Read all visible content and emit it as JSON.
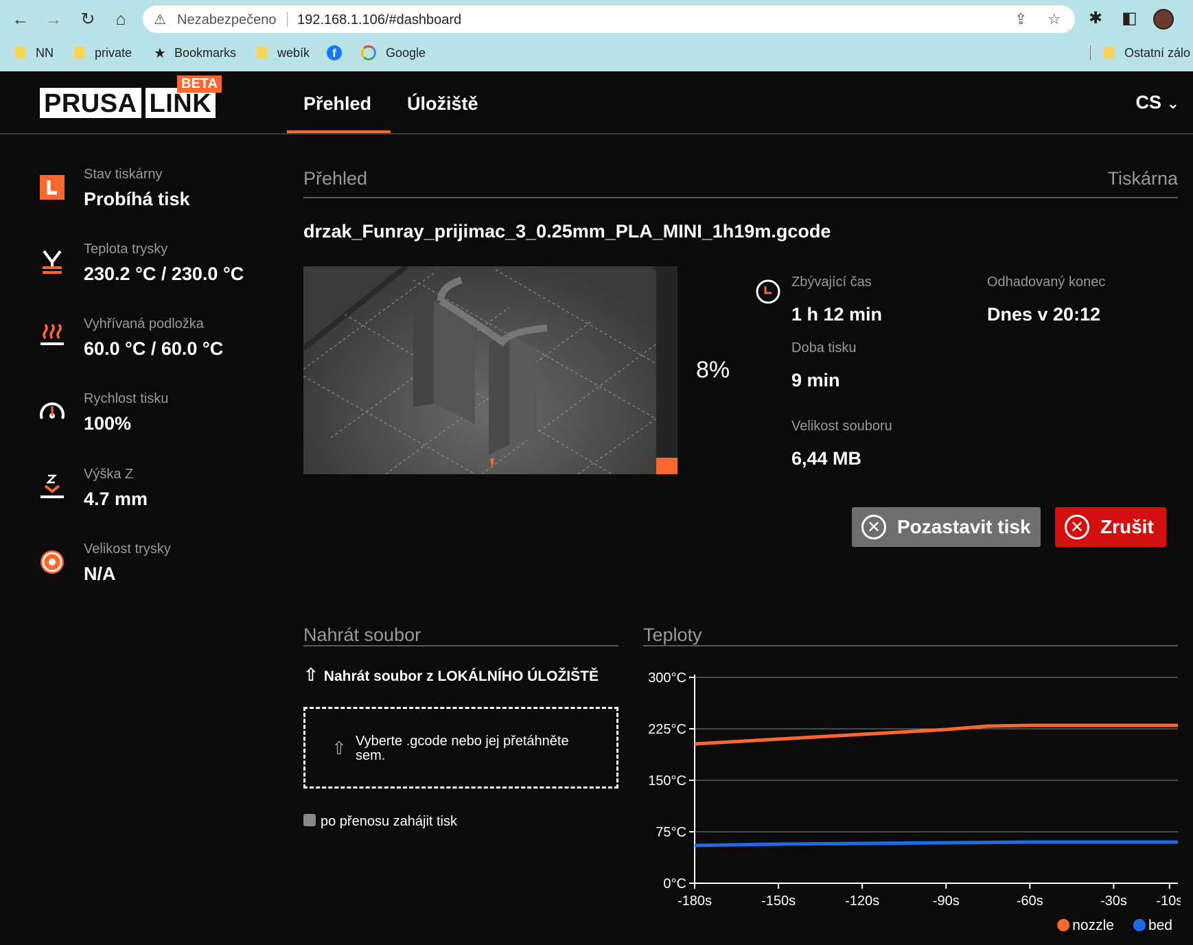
{
  "browser": {
    "security_text": "Nezabezpečeno",
    "url": "192.168.1.106/#dashboard",
    "bookmarks": [
      {
        "label": "NN"
      },
      {
        "label": "private"
      },
      {
        "label": "Bookmarks"
      },
      {
        "label": "webík"
      },
      {
        "label": ""
      },
      {
        "label": "Google"
      }
    ],
    "other_bookmarks": "Ostatní zálo"
  },
  "header": {
    "logo_left": "PRUSA",
    "logo_right": "LINK",
    "beta": "BETA",
    "nav": [
      "Přehled",
      "Úložiště"
    ],
    "active_nav": 0,
    "lang": "CS"
  },
  "sidebar": {
    "items": [
      {
        "label": "Stav tiskárny",
        "value": "Probíhá tisk",
        "icon": "printer-state-icon"
      },
      {
        "label": "Teplota trysky",
        "value": "230.2 °C / 230.0 °C",
        "icon": "nozzle-temp-icon"
      },
      {
        "label": "Vyhřívaná podložka",
        "value": "60.0 °C / 60.0 °C",
        "icon": "heatbed-icon"
      },
      {
        "label": "Rychlost tisku",
        "value": "100%",
        "icon": "speed-gauge-icon"
      },
      {
        "label": "Výška Z",
        "value": "4.7 mm",
        "icon": "z-height-icon"
      },
      {
        "label": "Velikost trysky",
        "value": "N/A",
        "icon": "nozzle-size-icon"
      }
    ]
  },
  "overview": {
    "title": "Přehled",
    "printer_link": "Tiskárna",
    "file_name": "drzak_Funray_prijimac_3_0.25mm_PLA_MINI_1h19m.gcode",
    "progress_text": "8%",
    "progress": 0.08,
    "remaining_label": "Zbývající čas",
    "remaining_value": "1 h 12 min",
    "end_label": "Odhadovaný konec",
    "end_value": "Dnes v 20:12",
    "print_time_label": "Doba tisku",
    "print_time_value": "9 min",
    "file_size_label": "Velikost souboru",
    "file_size_value": "6,44 MB",
    "pause_label": "Pozastavit tisk",
    "cancel_label": "Zrušit",
    "accent": "#fa6831",
    "cancel_color": "#d40f0f"
  },
  "upload": {
    "title": "Nahrát soubor",
    "link": "Nahrát soubor z LOKÁLNÍHO ÚLOŽIŠTĚ",
    "drop_text": "Vyberte .gcode nebo jej přetáhněte sem.",
    "checkbox_label": "po přenosu zahájit tisk"
  },
  "temps": {
    "title": "Teploty"
  },
  "chart_data": {
    "type": "line",
    "title": "",
    "xlabel": "",
    "ylabel": "",
    "xlim": [
      -180,
      -7
    ],
    "ylim": [
      0,
      300
    ],
    "x_ticks": [
      -180,
      -150,
      -120,
      -90,
      -60,
      -30,
      -10
    ],
    "x_tick_labels": [
      "-180s",
      "-150s",
      "-120s",
      "-90s",
      "-60s",
      "-30s",
      "-10s"
    ],
    "y_ticks": [
      0,
      75,
      150,
      225,
      300
    ],
    "y_tick_labels": [
      "0°C",
      "75°C",
      "150°C",
      "225°C",
      "300°C"
    ],
    "grid": true,
    "legend": "bottom-right",
    "series": [
      {
        "name": "nozzle",
        "color": "#fa6831",
        "x": [
          -180,
          -150,
          -120,
          -90,
          -75,
          -60,
          -30,
          -7
        ],
        "y": [
          203,
          210,
          217,
          224,
          229,
          230,
          230,
          230
        ]
      },
      {
        "name": "bed",
        "color": "#1e6be6",
        "x": [
          -180,
          -150,
          -120,
          -90,
          -60,
          -30,
          -7
        ],
        "y": [
          55,
          57,
          58,
          59,
          60,
          60,
          60
        ]
      }
    ]
  }
}
